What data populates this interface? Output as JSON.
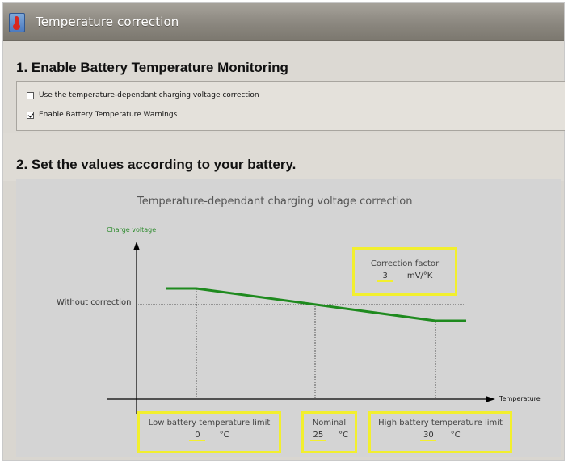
{
  "window": {
    "title": "Temperature correction",
    "icon": "thermometer-icon"
  },
  "section1": {
    "heading": "1. Enable Battery Temperature Monitoring",
    "options": [
      {
        "label": "Use the temperature-dependant charging voltage correction",
        "checked": false
      },
      {
        "label": "Enable Battery Temperature Warnings",
        "checked": true
      }
    ]
  },
  "section2": {
    "heading": "2. Set the values according to your battery."
  },
  "diagram": {
    "title": "Temperature-dependant charging voltage correction",
    "y_axis_label": "Charge voltage",
    "x_axis_label": "Temperature",
    "reference_label": "Without correction",
    "correction_factor": {
      "label": "Correction factor",
      "value": "3",
      "unit": "mV/°K"
    },
    "low_limit": {
      "label": "Low battery temperature limit",
      "value": "0",
      "unit": "°C"
    },
    "nominal": {
      "label": "Nominal",
      "value": "25",
      "unit": "°C"
    },
    "high_limit": {
      "label": "High battery temperature limit",
      "value": "30",
      "unit": "°C"
    }
  },
  "colors": {
    "highlight": "#f2ef2e",
    "curve": "#1e8a1e",
    "ylabel": "#2e8b2e"
  }
}
